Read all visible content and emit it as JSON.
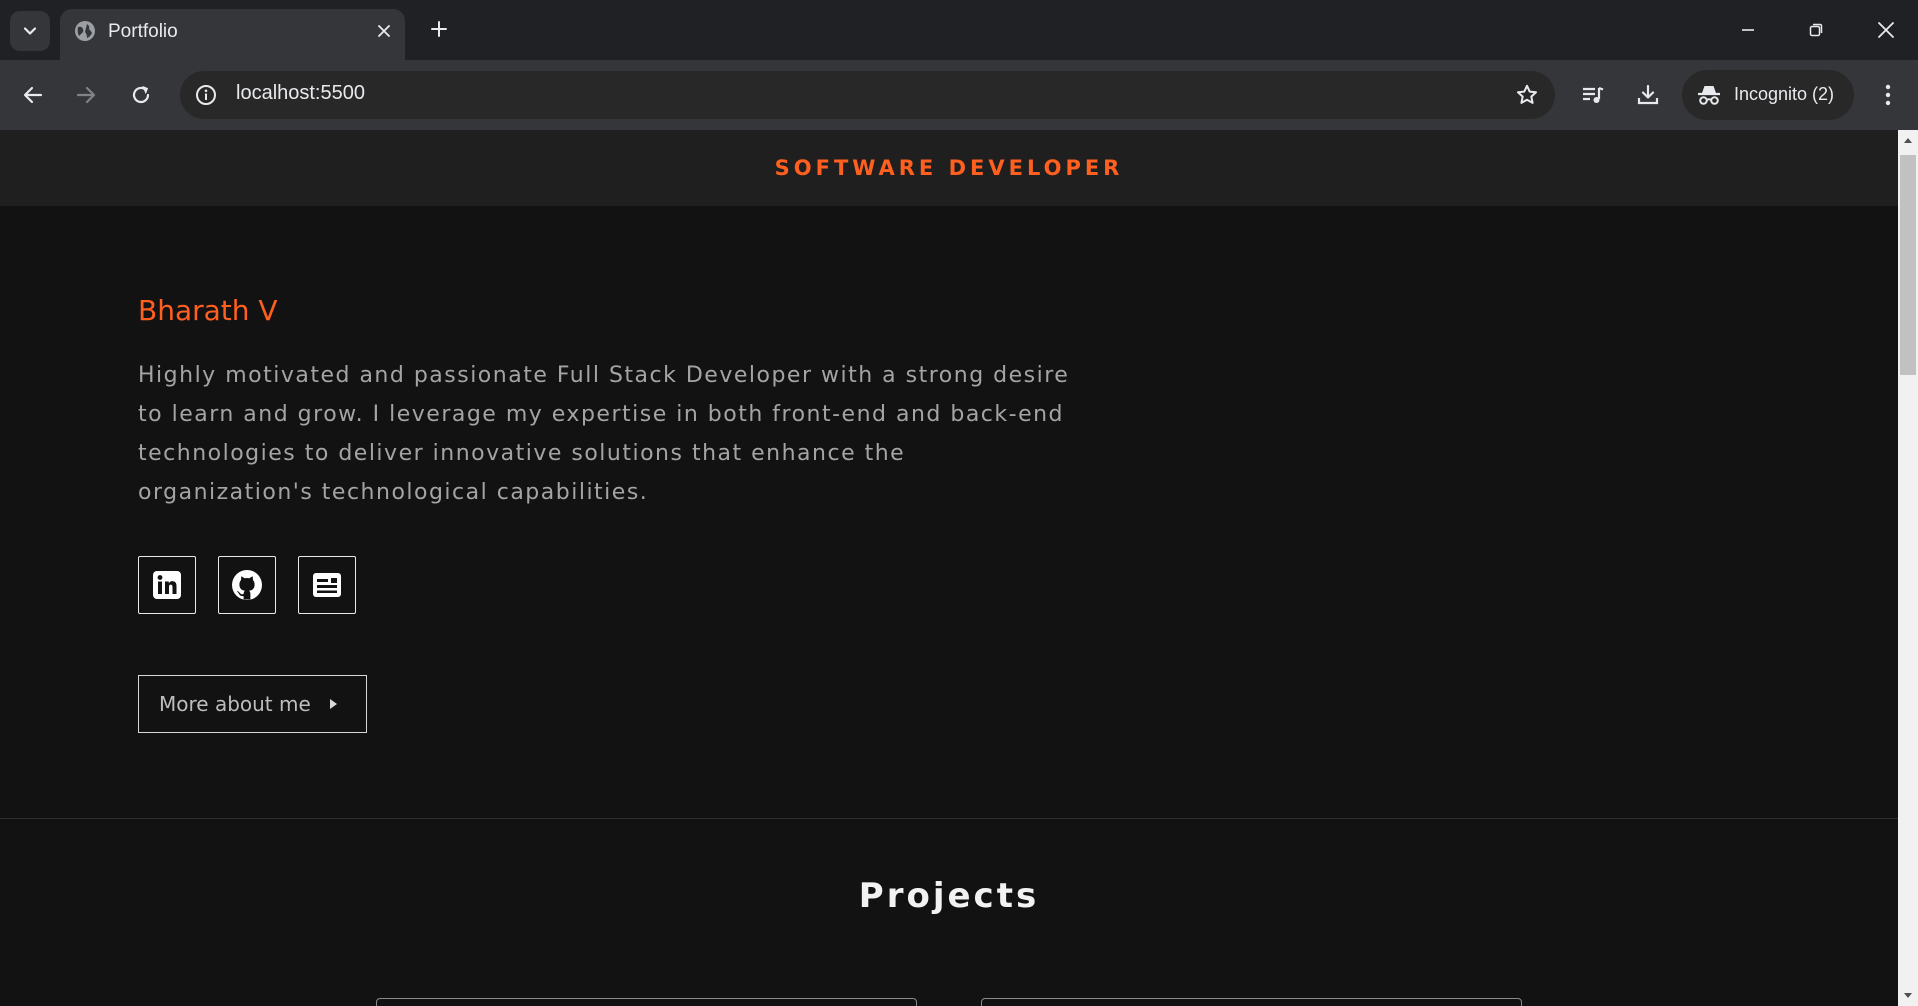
{
  "browser": {
    "tab": {
      "title": "Portfolio",
      "favicon": "globe-icon"
    },
    "address_bar": {
      "url": "localhost:5500"
    },
    "profile": {
      "label": "Incognito (2)"
    }
  },
  "page": {
    "header": {
      "role": "SOFTWARE DEVELOPER"
    },
    "hero": {
      "name": "Bharath V",
      "bio_lines": [
        "Highly motivated and passionate Full Stack Developer with a strong desire",
        "to learn and grow. I leverage my expertise in both front-end and back-end",
        "technologies to deliver innovative solutions that enhance the",
        "organization's technological capabilities."
      ],
      "social_links": [
        {
          "icon": "linkedin-icon"
        },
        {
          "icon": "github-icon"
        },
        {
          "icon": "resume-icon"
        }
      ],
      "more_button": "More about me"
    },
    "projects": {
      "title": "Projects"
    }
  },
  "colors": {
    "accent": "#ff5f1f",
    "page_background": "#121212",
    "header_background": "#1f1f1f",
    "chrome_dark": "#202124",
    "chrome_toolbar": "#35363a"
  }
}
